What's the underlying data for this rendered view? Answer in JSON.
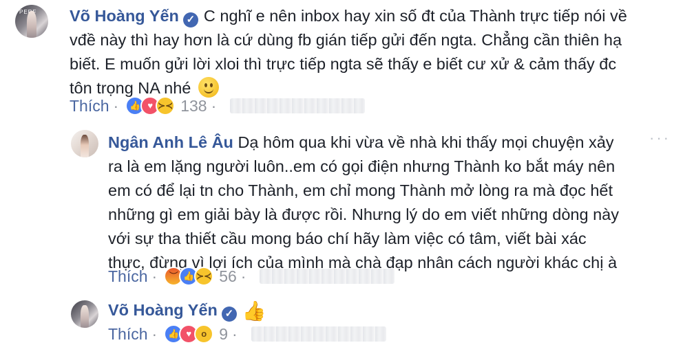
{
  "comments": [
    {
      "author": "Võ Hoàng Yến",
      "verified": true,
      "avatar_text": "PERF",
      "lines": [
        "C nghĩ e nên inbox hay xin số đt của Thành trực tiếp nói về",
        "vđề này thì hay hơn là cứ dùng fb gián tiếp gửi đến ngta. Chẳng cần thiên hạ",
        "biết. E muốn gửi lời xloi thì trực tiếp ngta sẽ thấy e biết cư xử & cảm thấy đc",
        "tôn trọng NA nhé"
      ],
      "trailing_emoji": "smile-emoji",
      "like_label": "Thích",
      "reactions": [
        "like",
        "love",
        "haha"
      ],
      "reaction_count": "138"
    },
    {
      "author": "Ngân Anh Lê Âu",
      "verified": false,
      "lines": [
        "Dạ hôm qua khi vừa về nhà khi thấy mọi chuyện xảy",
        "ra là em lặng người luôn..em có gọi điện nhưng Thành ko bắt máy nên",
        "em có để lại tn cho Thành, em chỉ mong Thành mở lòng ra mà đọc hết",
        "những gì em giải bày là được rồi. Nhưng lý do em viết những dòng này",
        "với sự tha thiết cầu mong báo chí hãy làm việc có tâm, viết bài xác",
        "thực, đừng vì lợi ích của mình mà chà đạp nhân cách người khác chị à"
      ],
      "more_icon": "···",
      "like_label": "Thích",
      "reactions": [
        "angry",
        "like",
        "haha"
      ],
      "reaction_count": "56"
    },
    {
      "author": "Võ Hoàng Yến",
      "verified": true,
      "body_emoji": "👍",
      "like_label": "Thích",
      "reactions": [
        "like",
        "love",
        "wow"
      ],
      "reaction_count": "9"
    }
  ],
  "colors": {
    "author": "#365899",
    "text": "#1d2129",
    "meta": "#90949c",
    "like_link": "#4b67a1"
  }
}
